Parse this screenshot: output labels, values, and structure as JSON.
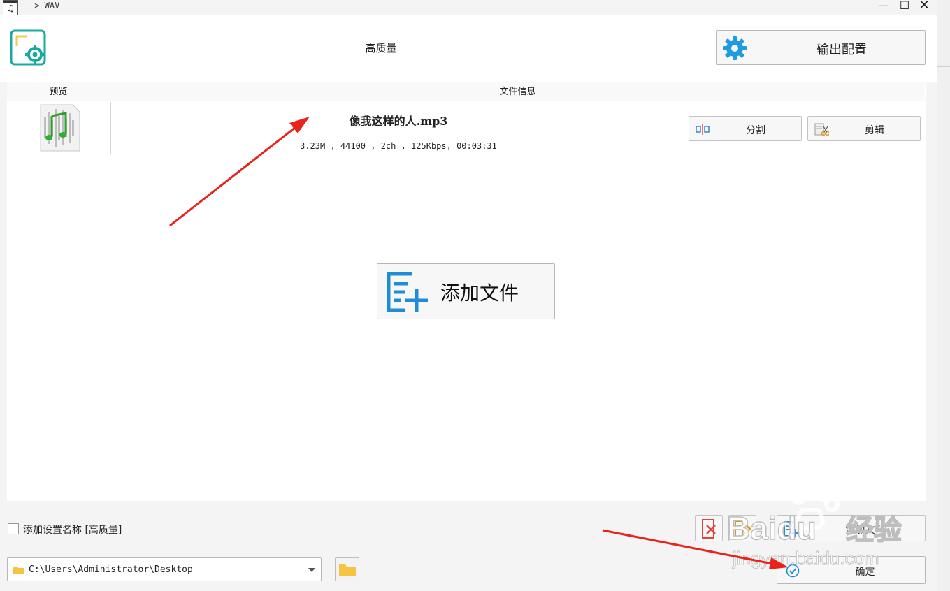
{
  "window": {
    "title": "-> WAV",
    "app_icon_glyph": "♫",
    "min_glyph": "—",
    "max_glyph": "☐",
    "close_glyph": "✕"
  },
  "header": {
    "preset": "高质量",
    "output_config_label": "输出配置"
  },
  "file_list": {
    "columns": [
      "预览",
      "文件信息"
    ],
    "rows": [
      {
        "name": "像我这样的人.mp3",
        "meta": "3.23M , 44100 , 2ch , 125Kbps, 00:03:31",
        "split_label": "分割",
        "edit_label": "剪辑"
      }
    ]
  },
  "center": {
    "add_file_label": "添加文件"
  },
  "bottom": {
    "add_preset_name_label": "添加设置名称 [高质量]",
    "output_path": "C:\\Users\\Administrator\\Desktop",
    "add_file_label": "添加文件",
    "ok_label": "确定"
  },
  "watermark": {
    "brand": "Baidu",
    "sub": "经验",
    "url": "jingyan.baidu.com"
  },
  "colors": {
    "accent_teal": "#1aa8a0",
    "accent_blue": "#1f8dd6",
    "arrow_red": "#e8231b"
  }
}
